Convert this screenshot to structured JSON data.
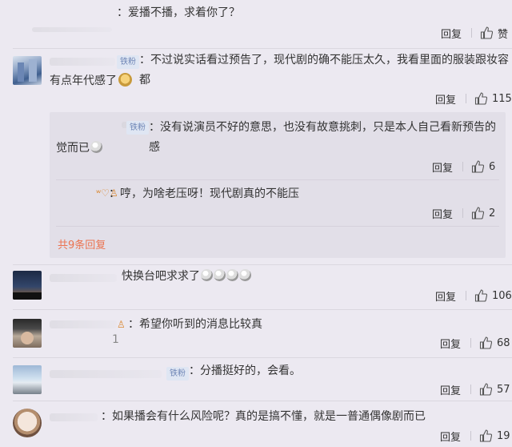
{
  "comments": [
    {
      "id": "c1",
      "text": "：爱播不播，求着你了？",
      "reply_label": "回复",
      "like_label": "赞"
    },
    {
      "id": "c2",
      "badge": "铁粉",
      "text_line1": "：不过说实话看过预告了，现代剧的确不能压太久，我看里面的服装跟妆容都",
      "text_line2": "有点年代感了",
      "reply_label": "回复",
      "like_count": "115",
      "replies": [
        {
          "badge": "铁粉",
          "text_line1": "：没有说演员不好的意思，也没有故意挑刺，只是本人自己看新预告的感",
          "text_line2": "觉而已",
          "reply_label": "回复",
          "like_count": "6"
        },
        {
          "text": "：哼，为啥老压呀！现代剧真的不能压",
          "reply_label": "回复",
          "like_count": "2"
        }
      ],
      "more_replies": "共9条回复"
    },
    {
      "id": "c3",
      "text": "快换台吧求求了",
      "reply_label": "回复",
      "like_count": "106"
    },
    {
      "id": "c4",
      "text": "：希望你听到的消息比较真",
      "reply_label": "回复",
      "like_count": "68"
    },
    {
      "id": "c5",
      "badge": "铁粉",
      "text": "：分播挺好的，会看。",
      "reply_label": "回复",
      "like_count": "57"
    },
    {
      "id": "c6",
      "text": "：如果播会有什么风险呢？真的是搞不懂，就是一普通偶像剧而已",
      "reply_label": "回复",
      "like_count": "19"
    }
  ],
  "colors": {
    "background": "#ece9f1",
    "badge_bg": "#dfe6f3",
    "badge_text": "#6f86b6",
    "link": "#eb7350"
  },
  "icons": [
    "thumbs-up-icon",
    "emoji-icon"
  ]
}
